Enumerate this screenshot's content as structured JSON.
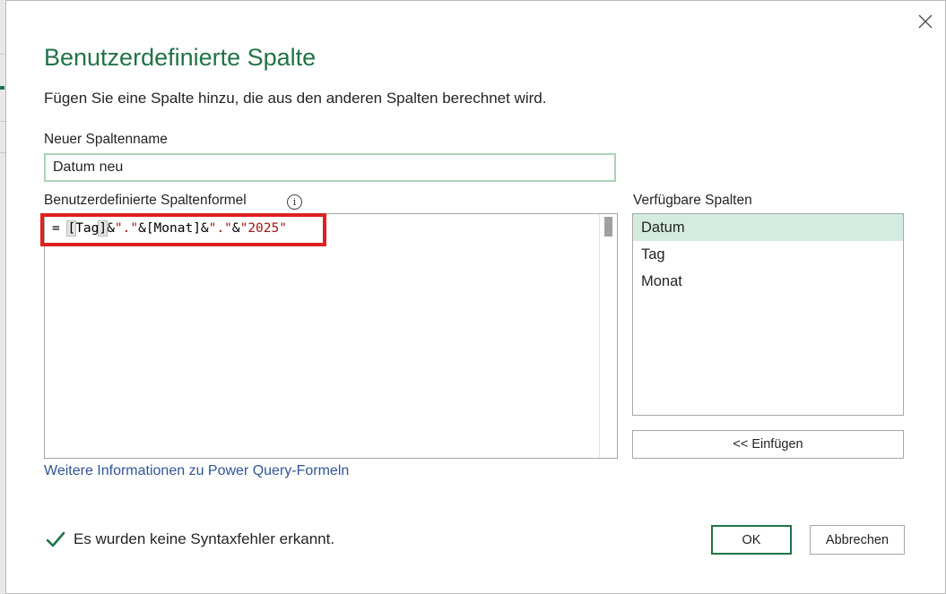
{
  "dialog": {
    "title": "Benutzerdefinierte Spalte",
    "subtitle": "Fügen Sie eine Spalte hinzu, die aus den anderen Spalten berechnet wird.",
    "close_icon": "close-icon"
  },
  "new_column": {
    "label": "Neuer Spaltenname",
    "value": "Datum neu"
  },
  "formula": {
    "label": "Benutzerdefinierte Spaltenformel",
    "info_icon": "info-icon",
    "info_glyph": "i",
    "prefix": "= ",
    "bracket_open": "[",
    "col1": "Tag",
    "bracket_close": "]",
    "amp1": "&",
    "str1": "\".\"",
    "amp2": "&",
    "col2_ref": "[Monat]",
    "amp3": "&",
    "str2": "\".\"",
    "amp4": "&",
    "str3": "\"2025\""
  },
  "available_columns": {
    "label": "Verfügbare Spalten",
    "items": [
      "Datum",
      "Tag",
      "Monat"
    ],
    "selected": "Datum"
  },
  "insert_button": "<< Einfügen",
  "info_link": "Weitere Informationen zu Power Query-Formeln",
  "status": {
    "icon": "checkmark-icon",
    "text": "Es wurden keine Syntaxfehler erkannt."
  },
  "buttons": {
    "ok": "OK",
    "cancel": "Abbrechen"
  },
  "colors": {
    "accent": "#217346",
    "highlight": "#e02020",
    "selection": "#d4ece0",
    "link": "#2f5597"
  }
}
